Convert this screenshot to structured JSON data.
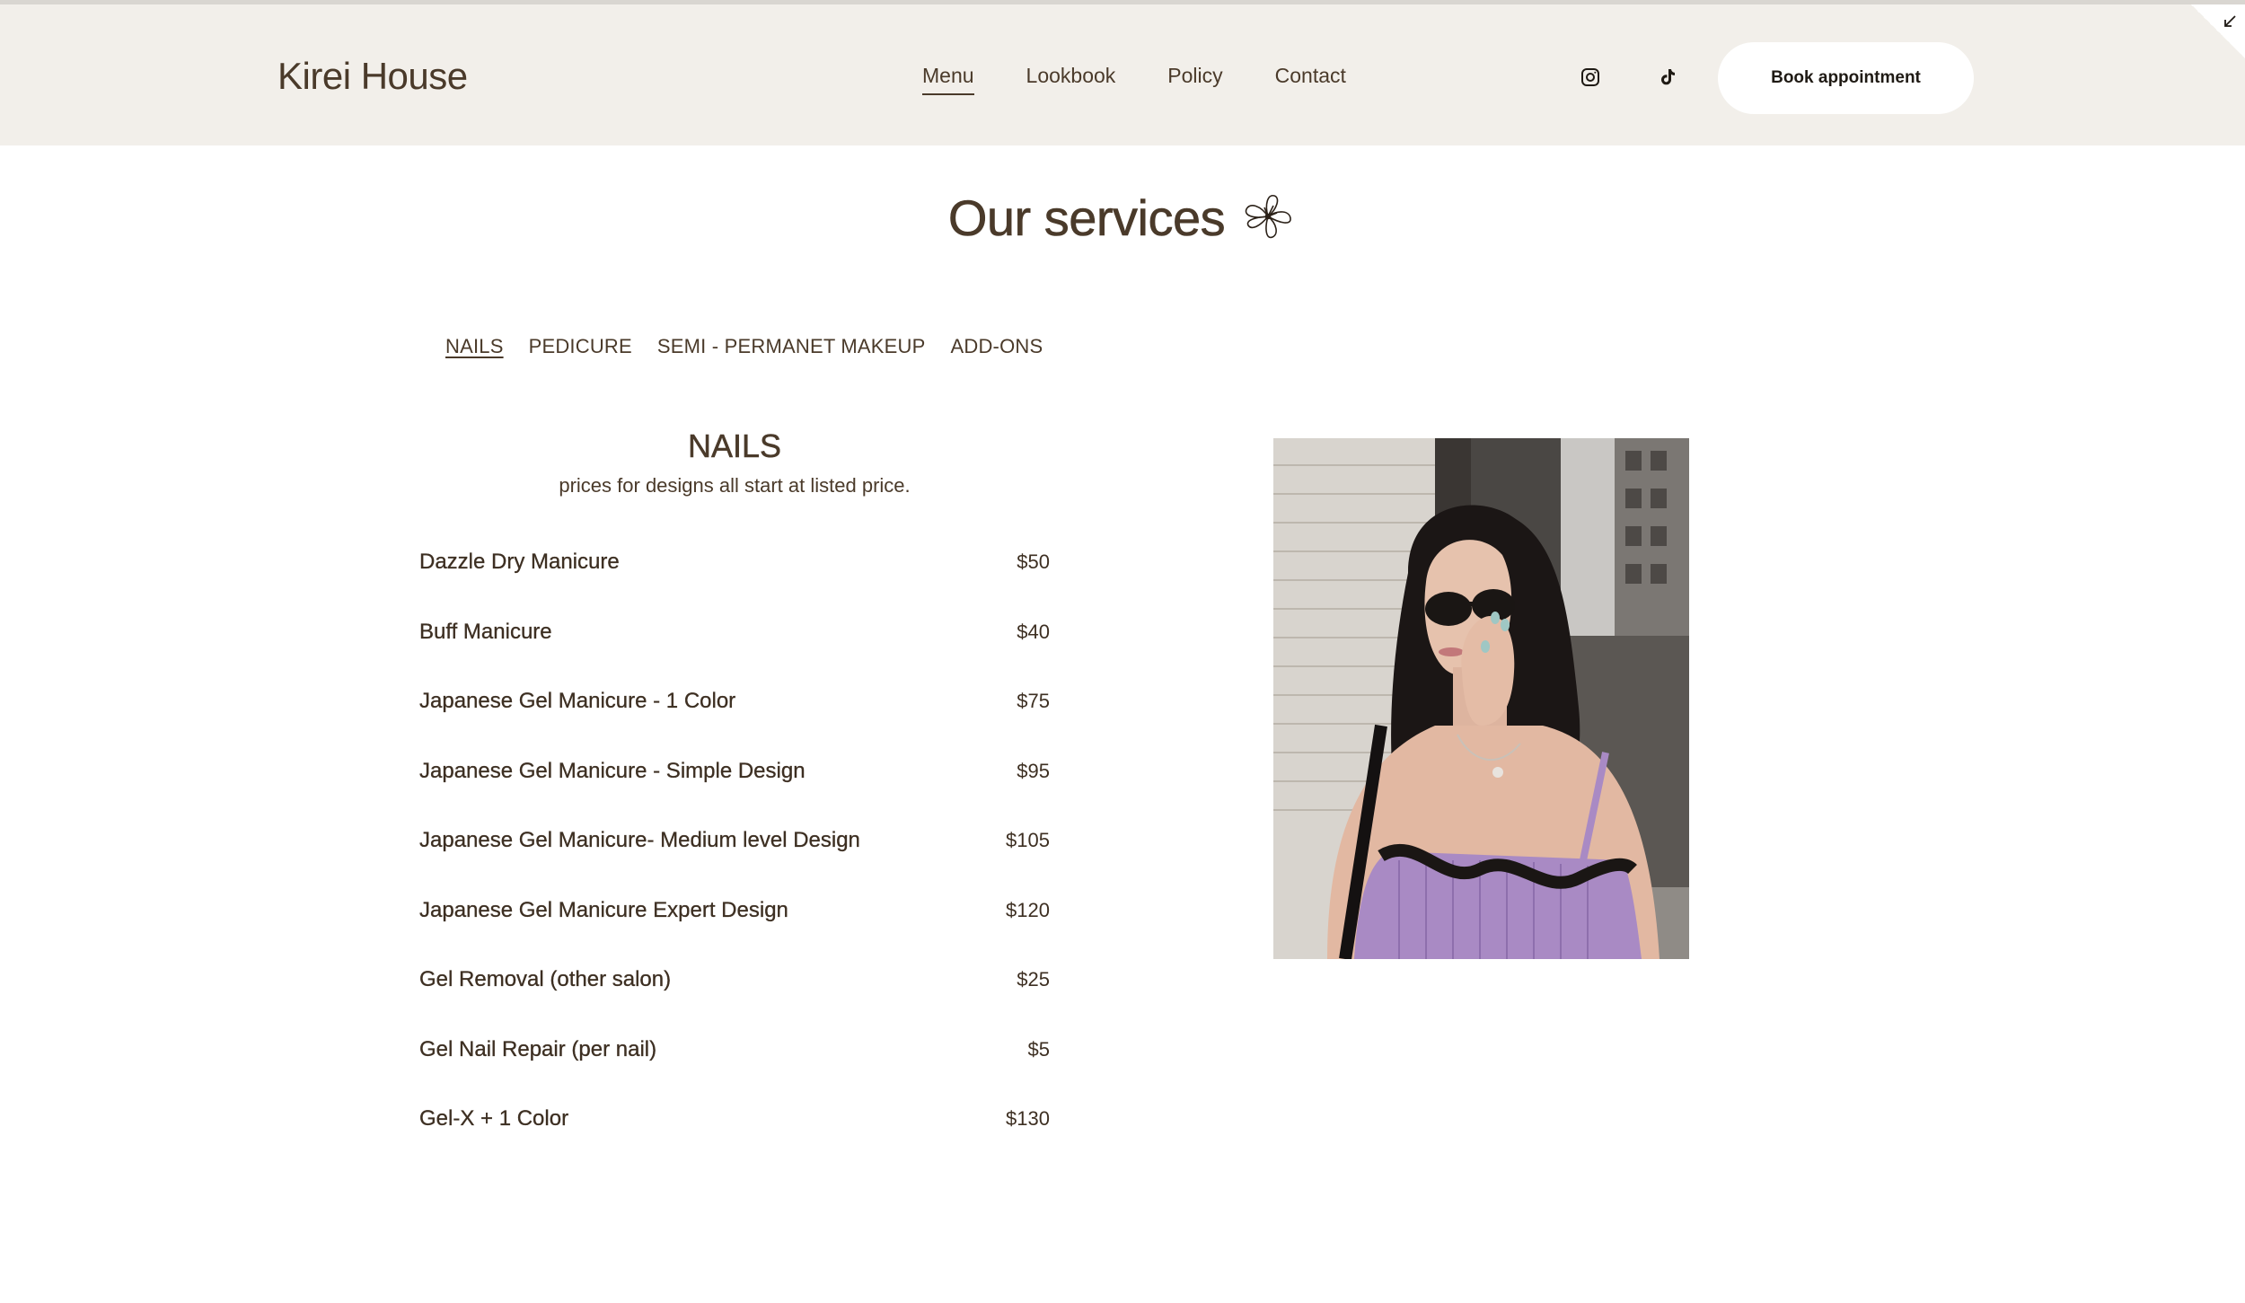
{
  "header": {
    "logo": "Kirei House",
    "nav": [
      {
        "label": "Menu",
        "active": true
      },
      {
        "label": "Lookbook",
        "active": false
      },
      {
        "label": "Policy",
        "active": false
      },
      {
        "label": "Contact",
        "active": false
      }
    ],
    "social_icons": [
      "instagram-icon",
      "tiktok-icon"
    ],
    "book_label": "Book appointment"
  },
  "page": {
    "title": "Our services",
    "title_icon": "flower-icon"
  },
  "tabs": [
    {
      "label": "NAILS",
      "active": true
    },
    {
      "label": "PEDICURE",
      "active": false
    },
    {
      "label": "SEMI - PERMANET MAKEUP",
      "active": false
    },
    {
      "label": "ADD-ONS",
      "active": false
    }
  ],
  "section": {
    "title": "NAILS",
    "note": "prices for designs all start at listed price.",
    "items": [
      {
        "name": "Dazzle Dry Manicure",
        "price": "$50"
      },
      {
        "name": "Buff Manicure",
        "price": "$40"
      },
      {
        "name": "Japanese Gel Manicure - 1 Color",
        "price": "$75"
      },
      {
        "name": "Japanese Gel Manicure - Simple Design",
        "price": "$95"
      },
      {
        "name": "Japanese Gel Manicure- Medium level Design",
        "price": "$105"
      },
      {
        "name": "Japanese Gel Manicure Expert Design",
        "price": "$120"
      },
      {
        "name": "Gel Removal (other salon)",
        "price": "$25"
      },
      {
        "name": "Gel Nail Repair (per nail)",
        "price": "$5"
      },
      {
        "name": "Gel-X + 1 Color",
        "price": "$130"
      }
    ]
  },
  "colors": {
    "header_bg": "#f2efea",
    "text": "#4a3a2a",
    "button_bg": "#ffffff"
  }
}
